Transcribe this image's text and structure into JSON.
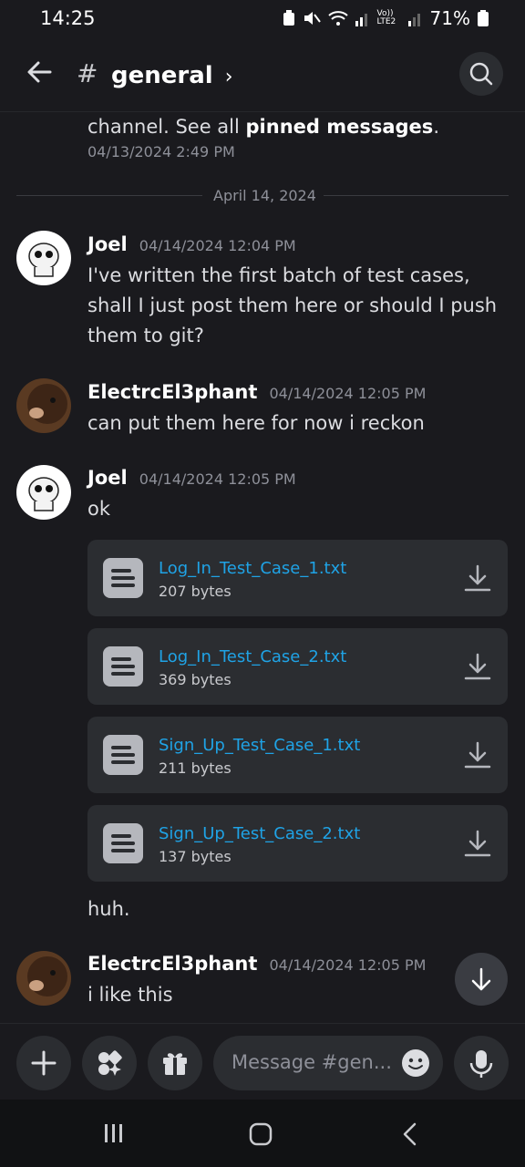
{
  "status": {
    "time": "14:25",
    "battery": "71%",
    "net": "Vo)) LTE2"
  },
  "header": {
    "channel_hash": "#",
    "channel": "general",
    "chevron": "›"
  },
  "pinned": {
    "prefix": "channel. See all ",
    "link": "pinned messages",
    "suffix": ".",
    "timestamp": "04/13/2024 2:49 PM"
  },
  "date_separator": "April 14, 2024",
  "messages": [
    {
      "author": "Joel",
      "timestamp": "04/14/2024 12:04 PM",
      "lines": [
        "I've written the first batch of test cases,",
        "shall I just post them here or should I push",
        "them to git?"
      ]
    },
    {
      "author": "ElectrcEl3phant",
      "timestamp": "04/14/2024 12:05 PM",
      "lines": [
        "can put them here for now i reckon"
      ]
    },
    {
      "author": "Joel",
      "timestamp": "04/14/2024 12:05 PM",
      "lines": [
        "ok"
      ]
    },
    {
      "lines": [
        "huh."
      ]
    },
    {
      "author": "ElectrcEl3phant",
      "timestamp": "04/14/2024 12:05 PM",
      "lines": [
        "i like this"
      ]
    }
  ],
  "attachments": [
    {
      "name": "Log_In_Test_Case_1.txt",
      "size": "207 bytes"
    },
    {
      "name": "Log_In_Test_Case_2.txt",
      "size": "369 bytes"
    },
    {
      "name": "Sign_Up_Test_Case_1.txt",
      "size": "211 bytes"
    },
    {
      "name": "Sign_Up_Test_Case_2.txt",
      "size": "137 bytes"
    }
  ],
  "composer": {
    "placeholder": "Message #gen..."
  },
  "icons": {
    "back": "arrow-left-icon",
    "search": "search-icon",
    "download": "download-icon",
    "file": "file-text-icon",
    "add": "plus-icon",
    "apps": "apps-icon",
    "gift": "gift-icon",
    "emoji": "emoji-icon",
    "mic": "microphone-icon",
    "scroll": "arrow-down-icon"
  },
  "colors": {
    "background": "#1a1a1e",
    "link": "#1fa3e6",
    "card": "#2b2d31"
  }
}
